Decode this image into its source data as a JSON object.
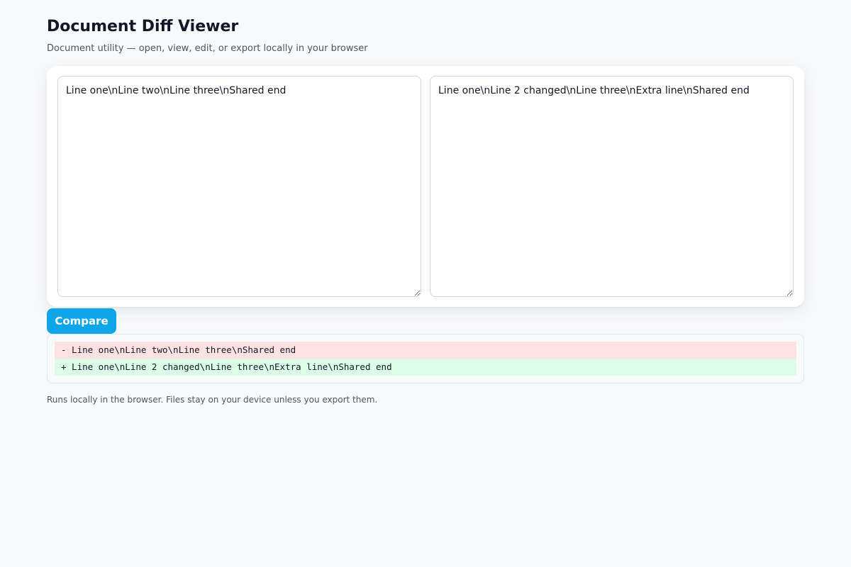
{
  "header": {
    "title": "Document Diff Viewer",
    "subtitle": "Document utility — open, view, edit, or export locally in your browser"
  },
  "editors": {
    "left_value": "Line one\\nLine two\\nLine three\\nShared end",
    "right_value": "Line one\\nLine 2 changed\\nLine three\\nExtra line\\nShared end"
  },
  "actions": {
    "compare_label": "Compare"
  },
  "diff": {
    "removed_line": "- Line one\\nLine two\\nLine three\\nShared end",
    "added_line": "+ Line one\\nLine 2 changed\\nLine three\\nExtra line\\nShared end"
  },
  "footer": {
    "note": "Runs locally in the browser. Files stay on your device unless you export them."
  },
  "colors": {
    "accent": "#0ea5e9",
    "removed_bg": "#fee2e2",
    "added_bg": "#dcfce7",
    "page_bg": "#f8f9fb"
  }
}
